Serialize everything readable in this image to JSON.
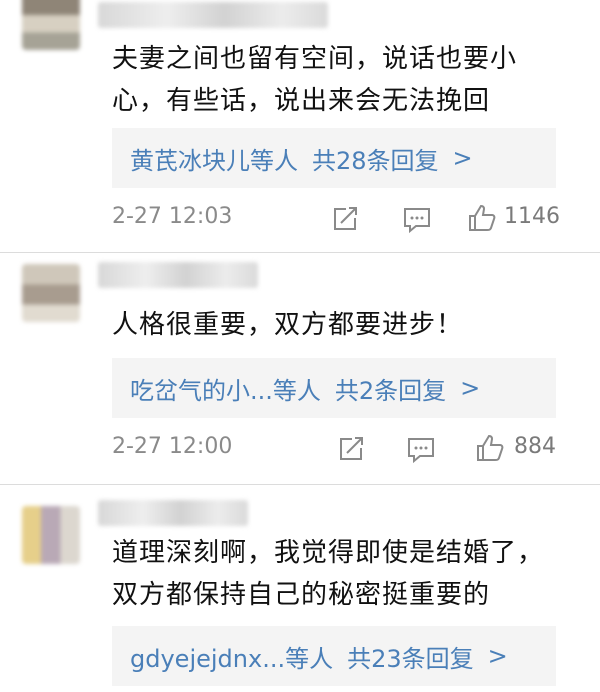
{
  "comments": [
    {
      "text": "夫妻之间也留有空间，说话也要小心，有些话，说出来会无法挽回",
      "reply_users": "黄芪冰块儿等人",
      "reply_count": "共28条回复",
      "reply_arrow": ">",
      "time": "2-27 12:03",
      "likes": "1146"
    },
    {
      "text": "人格很重要，双方都要进步！",
      "reply_users": "吃岔气的小...等人",
      "reply_count": "共2条回复",
      "reply_arrow": ">",
      "time": "2-27 12:00",
      "likes": "884"
    },
    {
      "text": "道理深刻啊，我觉得即使是结婚了，双方都保持自己的秘密挺重要的",
      "reply_users": "gdyejejdnx...等人",
      "reply_count": "共23条回复",
      "reply_arrow": ">"
    }
  ],
  "icons": {
    "share": "share-icon",
    "comment": "comment-icon",
    "like": "thumbs-up-icon"
  },
  "colors": {
    "link": "#4a7fb8",
    "meta": "#8a8a8a",
    "reply_bg": "#f4f4f4"
  }
}
